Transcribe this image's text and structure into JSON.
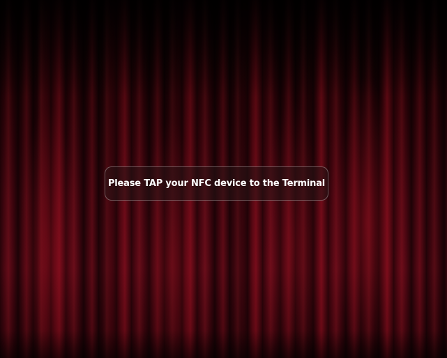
{
  "screen": {
    "background": "theater-curtain",
    "accent_color": "#5a0815"
  },
  "prompt": {
    "message": "Please TAP your NFC device to the Terminal"
  }
}
